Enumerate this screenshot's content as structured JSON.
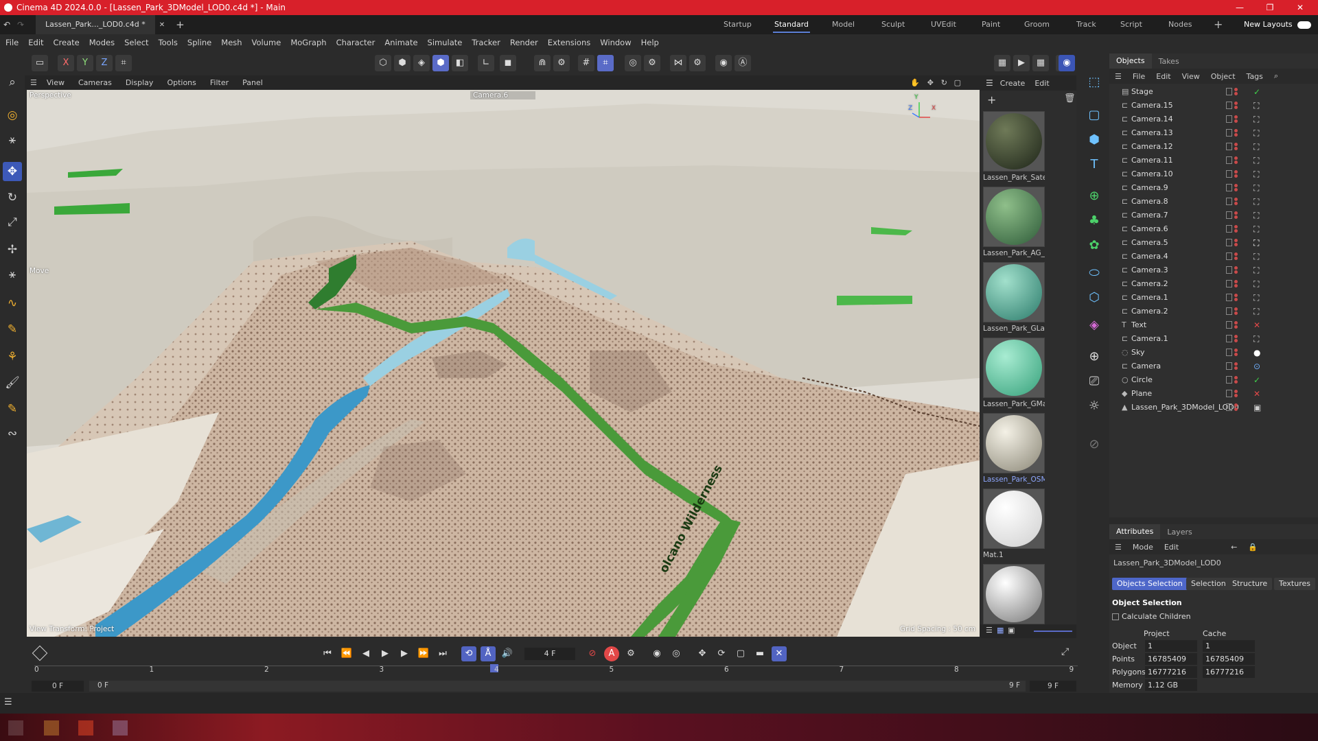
{
  "window": {
    "title": "Cinema 4D 2024.0.0 - [Lassen_Park_3DModel_LOD0.c4d *] - Main"
  },
  "doc_tab": "Lassen_Park..._LOD0.c4d *",
  "layouts": [
    "Startup",
    "Standard",
    "Model",
    "Sculpt",
    "UVEdit",
    "Paint",
    "Groom",
    "Track",
    "Script",
    "Nodes"
  ],
  "layouts_active": "Standard",
  "new_layouts": "New Layouts",
  "menu": [
    "File",
    "Edit",
    "Create",
    "Modes",
    "Select",
    "Tools",
    "Spline",
    "Mesh",
    "Volume",
    "MoGraph",
    "Character",
    "Animate",
    "Simulate",
    "Tracker",
    "Render",
    "Extensions",
    "Window",
    "Help"
  ],
  "axes": {
    "x": "X",
    "y": "Y",
    "z": "Z"
  },
  "viewport_menu": [
    "View",
    "Cameras",
    "Display",
    "Options",
    "Filter",
    "Panel"
  ],
  "viewport": {
    "perspective": "Perspective",
    "camera": "Camera.6",
    "move": "Move",
    "transform": "View Transform: Project",
    "grid": "Grid Spacing : 50 cm",
    "label_text": "olcano Wilderness",
    "axis_letters": {
      "y": "Y",
      "z": "Z",
      "x": "X"
    }
  },
  "materials_menu": [
    "Create",
    "Edit"
  ],
  "materials": [
    {
      "name": "Lassen_Park_Satel",
      "c1": "#6f7a58",
      "c2": "#1d2418"
    },
    {
      "name": "Lassen_Park_AG_L",
      "c1": "#8fbf8a",
      "c2": "#2d5a38"
    },
    {
      "name": "Lassen_Park_GLan",
      "c1": "#a2e0cc",
      "c2": "#2a7a6a"
    },
    {
      "name": "Lassen_Park_GMa",
      "c1": "#a8ecd2",
      "c2": "#35a07a"
    },
    {
      "name": "Lassen_Park_OSM",
      "c1": "#f4f1e6",
      "c2": "#8a8676"
    },
    {
      "name": "Mat.1",
      "c1": "#ffffff",
      "c2": "#cfcfcf"
    },
    {
      "name": "",
      "c1": "#ffffff",
      "c2": "#777777"
    }
  ],
  "materials_selected": 4,
  "objects_tabs": [
    "Objects",
    "Takes"
  ],
  "objects_menu": [
    "File",
    "Edit",
    "View",
    "Object",
    "Tags"
  ],
  "objects": [
    {
      "name": "Stage",
      "icon": "▤",
      "tag": "✓",
      "tagc": "#3fd04a"
    },
    {
      "name": "Camera.15",
      "icon": "⊏",
      "tag": "⛶",
      "tagc": "#ccc"
    },
    {
      "name": "Camera.14",
      "icon": "⊏",
      "tag": "⛶",
      "tagc": "#ccc"
    },
    {
      "name": "Camera.13",
      "icon": "⊏",
      "tag": "⛶",
      "tagc": "#ccc"
    },
    {
      "name": "Camera.12",
      "icon": "⊏",
      "tag": "⛶",
      "tagc": "#ccc"
    },
    {
      "name": "Camera.11",
      "icon": "⊏",
      "tag": "⛶",
      "tagc": "#ccc"
    },
    {
      "name": "Camera.10",
      "icon": "⊏",
      "tag": "⛶",
      "tagc": "#ccc"
    },
    {
      "name": "Camera.9",
      "icon": "⊏",
      "tag": "⛶",
      "tagc": "#ccc"
    },
    {
      "name": "Camera.8",
      "icon": "⊏",
      "tag": "⛶",
      "tagc": "#ccc"
    },
    {
      "name": "Camera.7",
      "icon": "⊏",
      "tag": "⛶",
      "tagc": "#ccc"
    },
    {
      "name": "Camera.6",
      "icon": "⊏",
      "tag": "⛶",
      "tagc": "#ccc"
    },
    {
      "name": "Camera.5",
      "icon": "⊏",
      "tag": "⛶",
      "tagc": "#fff"
    },
    {
      "name": "Camera.4",
      "icon": "⊏",
      "tag": "⛶",
      "tagc": "#ccc"
    },
    {
      "name": "Camera.3",
      "icon": "⊏",
      "tag": "⛶",
      "tagc": "#ccc"
    },
    {
      "name": "Camera.2",
      "icon": "⊏",
      "tag": "⛶",
      "tagc": "#ccc"
    },
    {
      "name": "Camera.1",
      "icon": "⊏",
      "tag": "⛶",
      "tagc": "#ccc"
    },
    {
      "name": "Camera.2",
      "icon": "⊏",
      "tag": "⛶",
      "tagc": "#ccc"
    },
    {
      "name": "Text",
      "icon": "T",
      "tag": "✕",
      "tagc": "#e24848"
    },
    {
      "name": "Camera.1",
      "icon": "⊏",
      "tag": "⛶",
      "tagc": "#ccc"
    },
    {
      "name": "Sky",
      "icon": "◌",
      "tag": "●",
      "tagc": "#fff"
    },
    {
      "name": "Camera",
      "icon": "⊏",
      "tag": "⊙",
      "tagc": "#6fb0ff"
    },
    {
      "name": "Circle",
      "icon": "○",
      "tag": "✓",
      "tagc": "#3fd04a"
    },
    {
      "name": "Plane",
      "icon": "◆",
      "tag": "✕",
      "tagc": "#e24848"
    },
    {
      "name": "Lassen_Park_3DModel_LOD0",
      "icon": "▲",
      "tag": "▣",
      "tagc": "#ccc"
    }
  ],
  "attributes": {
    "tabs": [
      "Attributes",
      "Layers"
    ],
    "menu": [
      "Mode",
      "Edit"
    ],
    "object_name": "Lassen_Park_3DModel_LOD0",
    "subtabs": [
      "Objects Selection",
      "Selection",
      "Structure",
      "Textures"
    ],
    "section": "Object Selection",
    "checkbox": "Calculate Children",
    "col_project": "Project",
    "col_cache": "Cache",
    "rows": [
      {
        "label": "Object",
        "project": "1",
        "cache": "1"
      },
      {
        "label": "Points",
        "project": "16785409",
        "cache": "16785409"
      },
      {
        "label": "Polygons",
        "project": "16777216",
        "cache": "16777216"
      },
      {
        "label": "Memory",
        "project": "1.12 GB",
        "cache": ""
      }
    ]
  },
  "timeline": {
    "frame": "4 F",
    "start": "0 F",
    "start2": "0 F",
    "end": "9 F",
    "end2": "9 F",
    "ticks": [
      "0",
      "1",
      "2",
      "3",
      "4",
      "5",
      "6",
      "7",
      "8",
      "9"
    ],
    "current": 4
  }
}
